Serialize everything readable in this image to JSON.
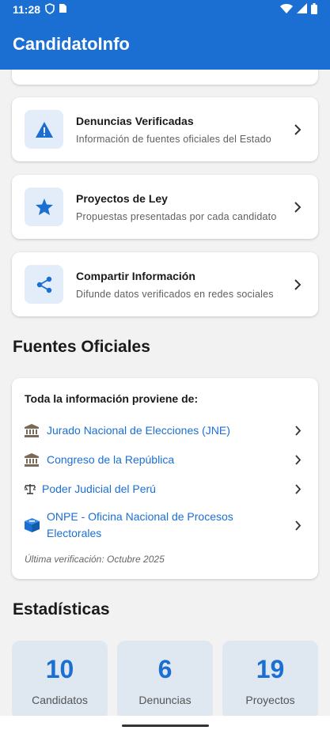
{
  "status": {
    "time": "11:28",
    "icons": [
      "shield-icon",
      "sim-card-icon",
      "wifi-icon",
      "signal-icon",
      "battery-icon"
    ]
  },
  "app": {
    "title": "CandidatoInfo",
    "accent": "#1b6fd3"
  },
  "features": [
    {
      "title": "Denuncias Verificadas",
      "subtitle": "Información de fuentes oficiales del Estado",
      "icon": "warning-icon"
    },
    {
      "title": "Proyectos de Ley",
      "subtitle": "Propuestas presentadas por cada candidato",
      "icon": "star-icon"
    },
    {
      "title": "Compartir Información",
      "subtitle": "Difunde datos verificados en redes sociales",
      "icon": "share-icon"
    }
  ],
  "sources": {
    "section_title": "Fuentes Oficiales",
    "header": "Toda la información proviene de:",
    "items": [
      {
        "label": "Jurado Nacional de Elecciones (JNE)",
        "icon": "bank-icon"
      },
      {
        "label": "Congreso de la República",
        "icon": "bank-icon"
      },
      {
        "label": "Poder Judicial del Perú",
        "icon": "scales-icon"
      },
      {
        "label": "ONPE - Oficina Nacional de Procesos Electorales",
        "icon": "ballot-box-icon"
      }
    ],
    "footer": "Última verificación: Octubre 2025"
  },
  "stats": {
    "section_title": "Estadísticas",
    "items": [
      {
        "value": "10",
        "label": "Candidatos"
      },
      {
        "value": "6",
        "label": "Denuncias"
      },
      {
        "value": "19",
        "label": "Proyectos"
      }
    ]
  }
}
